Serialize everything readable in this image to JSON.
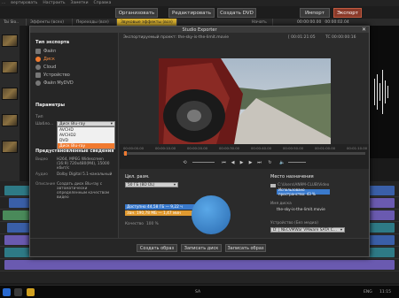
{
  "app": {
    "menu": [
      "...",
      "вертировать",
      "Настроить",
      "Заметки",
      "Справка"
    ],
    "modes": [
      "Организовать",
      "Редактировать",
      "Создать DVD",
      "Импорт",
      "Экспорт"
    ],
    "active_mode": "Экспорт",
    "tabs": [
      "Tai Slo..",
      "Эффекты (всех)",
      "Переходы (все)",
      "Звуковые эффекты (все)",
      "Начать"
    ],
    "timecode": "00:00:02.04",
    "timecode2": "00:00:00.00"
  },
  "dialog": {
    "title": "Studio Exporter",
    "close_label": "✕",
    "export_type_title": "Тип экспорта",
    "export_types": [
      {
        "label": "Файл",
        "selected": false
      },
      {
        "label": "Диск",
        "selected": true
      },
      {
        "label": "Cloud",
        "selected": false
      },
      {
        "label": "Устройство",
        "selected": false
      },
      {
        "label": "Файл MyDVD",
        "selected": false
      }
    ],
    "params_title": "Параметры",
    "type_label": "Тип",
    "type_value": "Диск Blu-ray",
    "template_label": "Шабло...",
    "type_options": [
      "Диск Blu-ray",
      "AVCHD",
      "AVCHD2",
      "DVD"
    ],
    "type_highlight": "Диск Blu-ray",
    "preview_info_title": "Предустановленные сведения",
    "video_label": "Видео",
    "video_value": "H264, MPEG Widescreen (16:9) 720x480(M4), 15000 кбит/с",
    "audio_label": "Аудио",
    "audio_value": "Dolby Digital 5.1-канальный",
    "desc_label": "Описание",
    "desc_value": "Создать диск Blu-ray с автоматически определенным качеством видео",
    "project_text": "Экспортируемый проект: the-sky-is-the-limit.movie",
    "tc_in": "[ 00:01:21:05",
    "tc_total": "TC 00:00:00:16",
    "scrub_ticks": [
      "00:00:00.00",
      "00:00:10.00",
      "00:00:20.00",
      "00:00:30.00",
      "00:00:40.00",
      "00:00:50.00",
      "00:01:00.00",
      "00:01:10.00"
    ],
    "target_title": "Цел. разм.",
    "target_value": "50 ГБ (BD DL)",
    "used_label": "Доступно",
    "used_value": "44,58 ГБ — 9,22 ч",
    "used_fraction": 0.86,
    "project_size_label": "Зан.",
    "project_size_value": "190,78 МБ — 1,47 мин",
    "quality_label": "Качество",
    "quality_value": "100 %",
    "dest_title": "Место назначения",
    "dest_path": "C:\\Users\\AN9M-CLUB\\Video",
    "dest_usage": "Использовано пространство: 43 %",
    "dest_usage_fraction": 0.43,
    "disc_name_label": "Имя диска",
    "disc_name_value": "the-sky-is-the-limit.movie",
    "device_label": "Устройство (Без медиа)",
    "device_value": "D: | NECVMWar VMware SATA C...",
    "buttons": {
      "create_image": "Создать образ",
      "burn_disc": "Записать диск",
      "burn_image": "Записать образ"
    }
  },
  "taskbar": {
    "tray_lang": "ENG",
    "tray_time": "11:15",
    "center": "SA"
  }
}
